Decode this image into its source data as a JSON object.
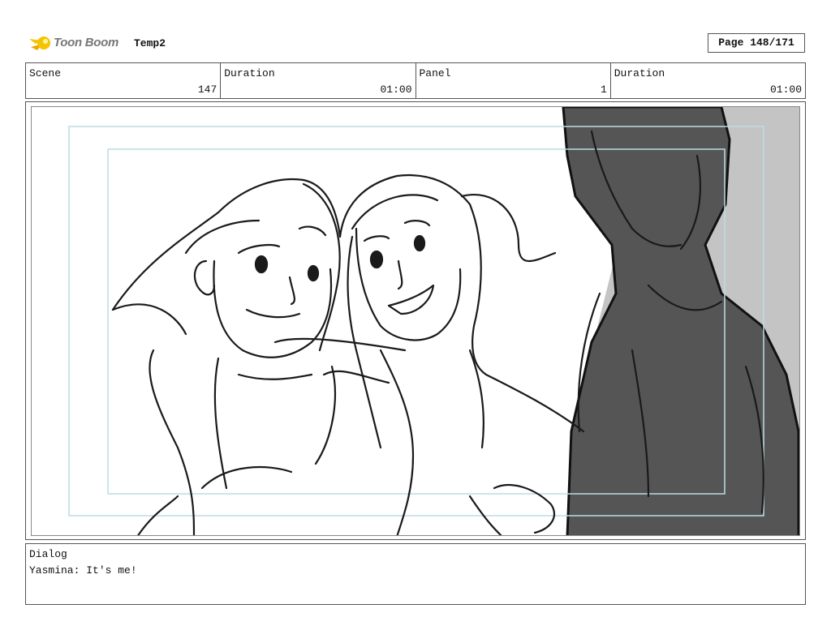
{
  "header": {
    "logo_text": "Toon Boom",
    "project_name": "Temp2",
    "page_label": "Page 148/171"
  },
  "info": {
    "scene_label": "Scene",
    "scene_value": "147",
    "scene_duration_label": "Duration",
    "scene_duration_value": "01:00",
    "panel_label": "Panel",
    "panel_value": "1",
    "panel_duration_label": "Duration",
    "panel_duration_value": "01:00"
  },
  "dialog": {
    "label": "Dialog",
    "text": "Yasmina: It's me!"
  },
  "colors": {
    "logo_star": "#f5c400",
    "logo_text": "#777777",
    "silhouette": "#555555",
    "shadow": "#c4c4c4",
    "safe_frame": "#bcdce4"
  }
}
